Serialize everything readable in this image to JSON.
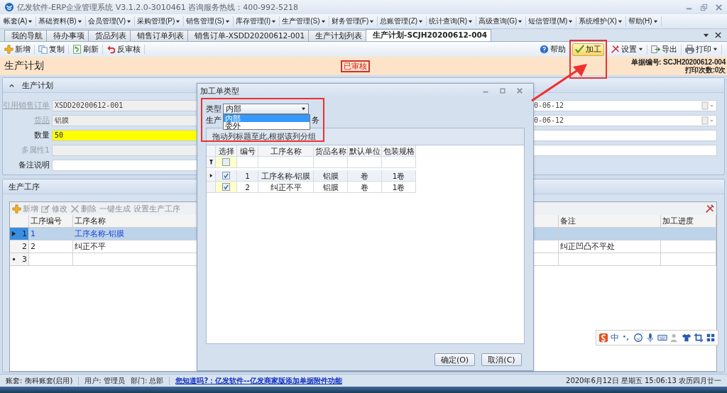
{
  "window": {
    "title": "亿发软件-ERP企业管理系统 V3.1.2.0-3010461 咨询服务热线：400-992-5218"
  },
  "menu": [
    {
      "label": "帐套(A)"
    },
    {
      "label": "基础资料(B)"
    },
    {
      "label": "会员管理(V)"
    },
    {
      "label": "采购管理(P)"
    },
    {
      "label": "销售管理(S)"
    },
    {
      "label": "库存管理(I)"
    },
    {
      "label": "生产管理(S)"
    },
    {
      "label": "财务管理(F)"
    },
    {
      "label": "总账管理(Z)"
    },
    {
      "label": "统计查询(R)"
    },
    {
      "label": "高级查询(G)"
    },
    {
      "label": "短信管理(M)"
    },
    {
      "label": "系统维护(X)"
    },
    {
      "label": "帮助(H)"
    }
  ],
  "tabs": [
    {
      "label": "我的导航",
      "selected": false
    },
    {
      "label": "待办事项",
      "selected": false
    },
    {
      "label": "货品列表",
      "selected": false
    },
    {
      "label": "销售订单列表",
      "selected": false
    },
    {
      "label": "销售订单-XSDD20200612-001",
      "selected": false
    },
    {
      "label": "生产计划列表",
      "selected": false
    },
    {
      "label": "生产计划-SCJH20200612-004",
      "selected": true
    }
  ],
  "toolbar": {
    "left": [
      {
        "label": "新增",
        "kind": "add"
      },
      {
        "label": "复制",
        "kind": "copy"
      },
      {
        "label": "刷新",
        "kind": "refresh"
      },
      {
        "label": "反审核",
        "kind": "undo"
      }
    ],
    "right": [
      {
        "label": "帮助",
        "kind": "help",
        "highlighted": false,
        "dropdown": false
      },
      {
        "label": "加工",
        "kind": "check",
        "highlighted": true,
        "dropdown": false
      },
      {
        "label": "设置",
        "kind": "settings",
        "highlighted": false,
        "dropdown": true
      },
      {
        "label": "导出",
        "kind": "export",
        "highlighted": false,
        "dropdown": false
      },
      {
        "label": "打印",
        "kind": "print",
        "highlighted": false,
        "dropdown": true
      }
    ]
  },
  "header": {
    "title": "生产计划",
    "status": "已审核",
    "doc_number": "单据编号: SCJH20200612-004",
    "print_count": "打印次数:0次"
  },
  "plan_panel": {
    "title": "生产计划",
    "fields": [
      {
        "label": "引用销售订单",
        "link": true,
        "disabled": true,
        "value": "XSDD20200612-001",
        "kind": "readonly"
      },
      {
        "label": "货品",
        "link": true,
        "disabled": true,
        "value": "铝膜",
        "kind": "readonly"
      },
      {
        "label": "数量",
        "link": false,
        "disabled": false,
        "value": "50",
        "kind": "required"
      },
      {
        "label": "多属性1",
        "link": false,
        "disabled": true,
        "kind": "readonly"
      },
      {
        "label": "备注说明",
        "link": false,
        "disabled": false,
        "kind": "text"
      }
    ],
    "right_fields": [
      {
        "value": "0-06-12",
        "kind": "date"
      },
      {
        "value": "0-06-12",
        "kind": "date"
      },
      {
        "kind": "text"
      },
      {
        "kind": "text"
      }
    ]
  },
  "process_panel": {
    "title": "生产工序",
    "toolbar": [
      {
        "label": "新增",
        "kind": "add",
        "disabled": true
      },
      {
        "label": "修改",
        "kind": "edit",
        "disabled": true
      },
      {
        "label": "删除",
        "kind": "delete",
        "disabled": true
      },
      {
        "label": "一键生成",
        "disabled": true
      },
      {
        "label": "设置生产工序",
        "disabled": true
      }
    ],
    "columns": [
      "工序编号",
      "工序名称",
      "备注",
      "加工进度"
    ],
    "rows": [
      {
        "index": "1",
        "code": "1",
        "name": "工序名称-铝膜",
        "selected": true,
        "kind": "row"
      },
      {
        "index": "2",
        "code": "2",
        "name": "纠正不平",
        "note": "纠正凹凸不平处",
        "selected": false,
        "kind": "row"
      },
      {
        "index": "3",
        "selected": false,
        "kind": "new"
      }
    ]
  },
  "dialog": {
    "title": "加工单类型",
    "type_label": "类型",
    "type_value": "内部",
    "options": [
      {
        "label": "内部",
        "selected": true
      },
      {
        "label": "委外",
        "selected": false
      }
    ],
    "behind_label": "生产",
    "behind_tail": "务",
    "group_hint": "拖动列标题至此,根据该列分组",
    "columns": [
      "选择",
      "编号",
      "工序名称",
      "货品名称",
      "默认单位",
      "包装规格"
    ],
    "filter_checked": false,
    "rows": [
      {
        "checked": true,
        "no": "1",
        "name": "工序名称-铝膜",
        "product": "铝膜",
        "unit": "卷",
        "pack": "1卷",
        "current": true
      },
      {
        "checked": true,
        "no": "2",
        "name": "纠正不平",
        "product": "铝膜",
        "unit": "卷",
        "pack": "1卷",
        "current": false
      }
    ],
    "buttons": [
      "确定(O)",
      "取消(C)"
    ]
  },
  "status_bar": {
    "account": "账套: 衡科账套(启用)",
    "user": "用户: 管理员",
    "dept": "部门: 总部",
    "tip": "您知道吗?：亿发软件--亿发商家版添加单据附件功能",
    "datetime": "2020年6月12日 星期五 15:06:13 农历四月廿一"
  },
  "ime": {
    "mode": "中"
  }
}
